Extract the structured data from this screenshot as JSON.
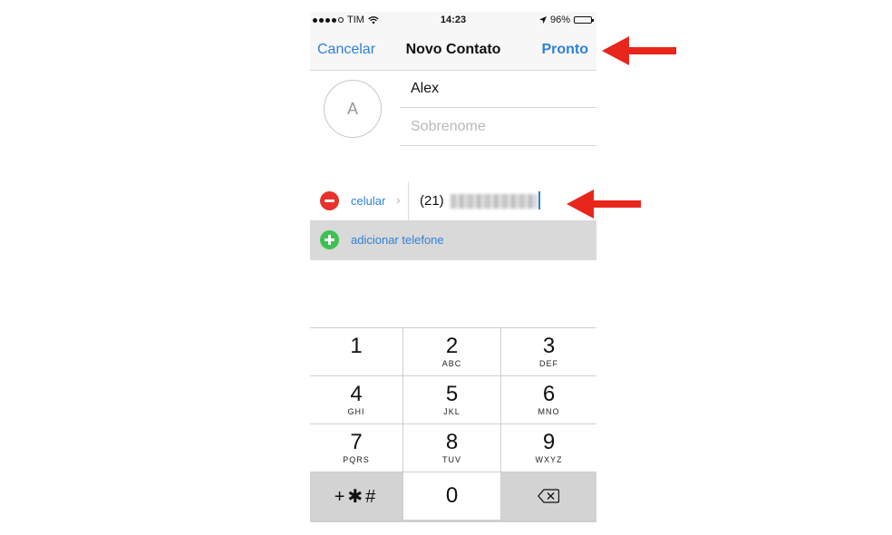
{
  "status_bar": {
    "carrier": "TIM",
    "time": "14:23",
    "battery": "96%",
    "battery_level": 0.96
  },
  "nav": {
    "cancel_label": "Cancelar",
    "title": "Novo Contato",
    "done_label": "Pronto"
  },
  "contact": {
    "avatar_initial": "A",
    "first_name_value": "Alex",
    "last_name_placeholder": "Sobrenome"
  },
  "phone": {
    "label": "celular",
    "chevron": "›",
    "number_prefix": "(21)"
  },
  "add_phone": {
    "label": "adicionar telefone"
  },
  "keypad": {
    "keys": [
      {
        "digit": "1",
        "letters": ""
      },
      {
        "digit": "2",
        "letters": "ABC"
      },
      {
        "digit": "3",
        "letters": "DEF"
      },
      {
        "digit": "4",
        "letters": "GHI"
      },
      {
        "digit": "5",
        "letters": "JKL"
      },
      {
        "digit": "6",
        "letters": "MNO"
      },
      {
        "digit": "7",
        "letters": "PQRS"
      },
      {
        "digit": "8",
        "letters": "TUV"
      },
      {
        "digit": "9",
        "letters": "WXYZ"
      }
    ],
    "symbols": "+✱#",
    "zero": "0"
  },
  "colors": {
    "accent": "#2f80d6",
    "remove": "#e8302c",
    "add": "#3ec153",
    "arrow": "#e8261b"
  }
}
